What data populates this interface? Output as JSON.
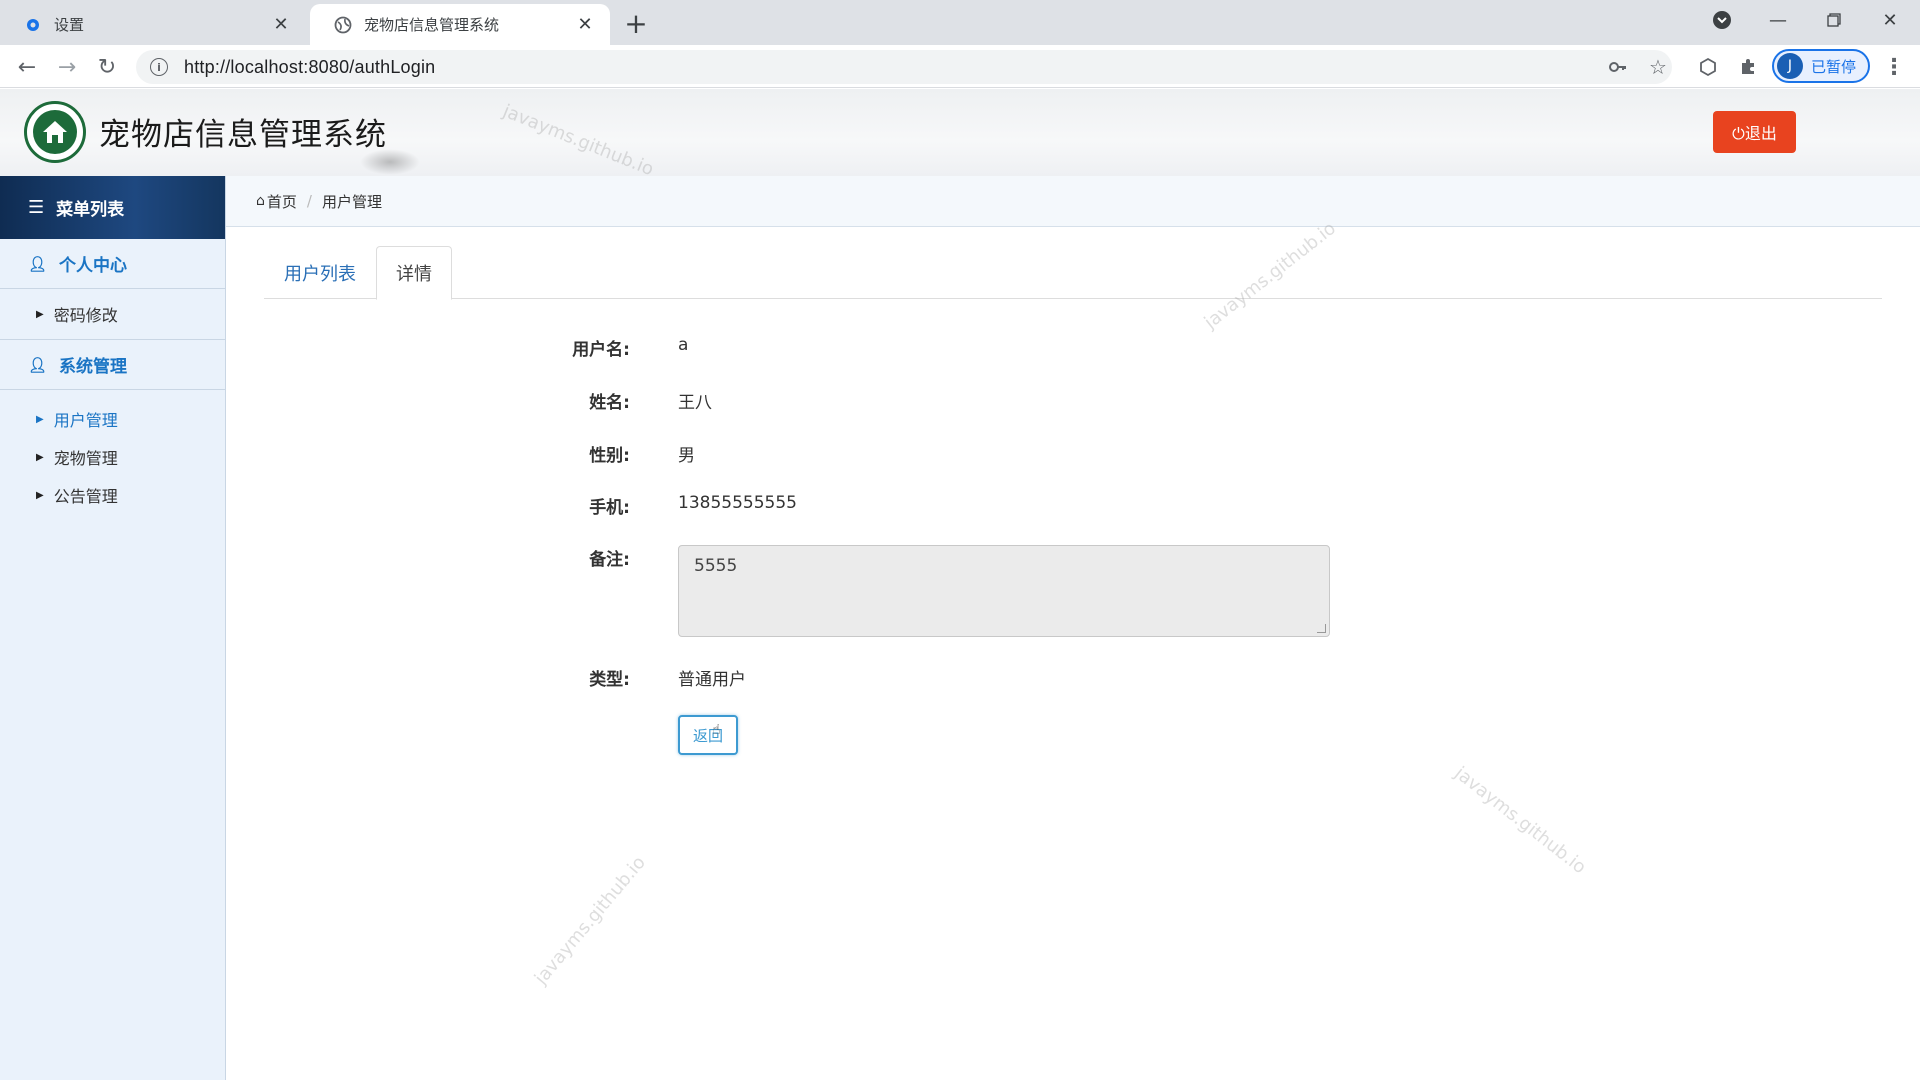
{
  "browser": {
    "tabs": [
      {
        "title": "设置",
        "icon": "gear-icon",
        "active": false
      },
      {
        "title": "宠物店信息管理系统",
        "icon": "globe-icon",
        "active": true
      }
    ],
    "url": "http://localhost:8080/authLogin",
    "profile_initial": "J",
    "profile_status": "已暂停"
  },
  "header": {
    "title": "宠物店信息管理系统",
    "logout_label": "⏻退出"
  },
  "sidebar": {
    "menu_title": "菜单列表",
    "groups": [
      {
        "title": "个人中心",
        "items": [
          {
            "label": "密码修改",
            "active": false
          }
        ]
      },
      {
        "title": "系统管理",
        "items": [
          {
            "label": "用户管理",
            "active": true
          },
          {
            "label": "宠物管理",
            "active": false
          },
          {
            "label": "公告管理",
            "active": false
          }
        ]
      }
    ]
  },
  "breadcrumb": {
    "home": "首页",
    "current": "用户管理"
  },
  "tabs": {
    "list": "用户列表",
    "detail": "详情",
    "active": "详情"
  },
  "form": {
    "username_label": "用户名:",
    "username": "a",
    "name_label": "姓名:",
    "name": "王八",
    "gender_label": "性别:",
    "gender": "男",
    "phone_label": "手机:",
    "phone": "13855555555",
    "remark_label": "备注:",
    "remark": "5555",
    "type_label": "类型:",
    "type": "普通用户",
    "back_label": "返回"
  },
  "watermark": "javayms.github.io",
  "colors": {
    "accent": "#1a74c4",
    "logout": "#e8431f",
    "menu_header": "#1e4880"
  }
}
